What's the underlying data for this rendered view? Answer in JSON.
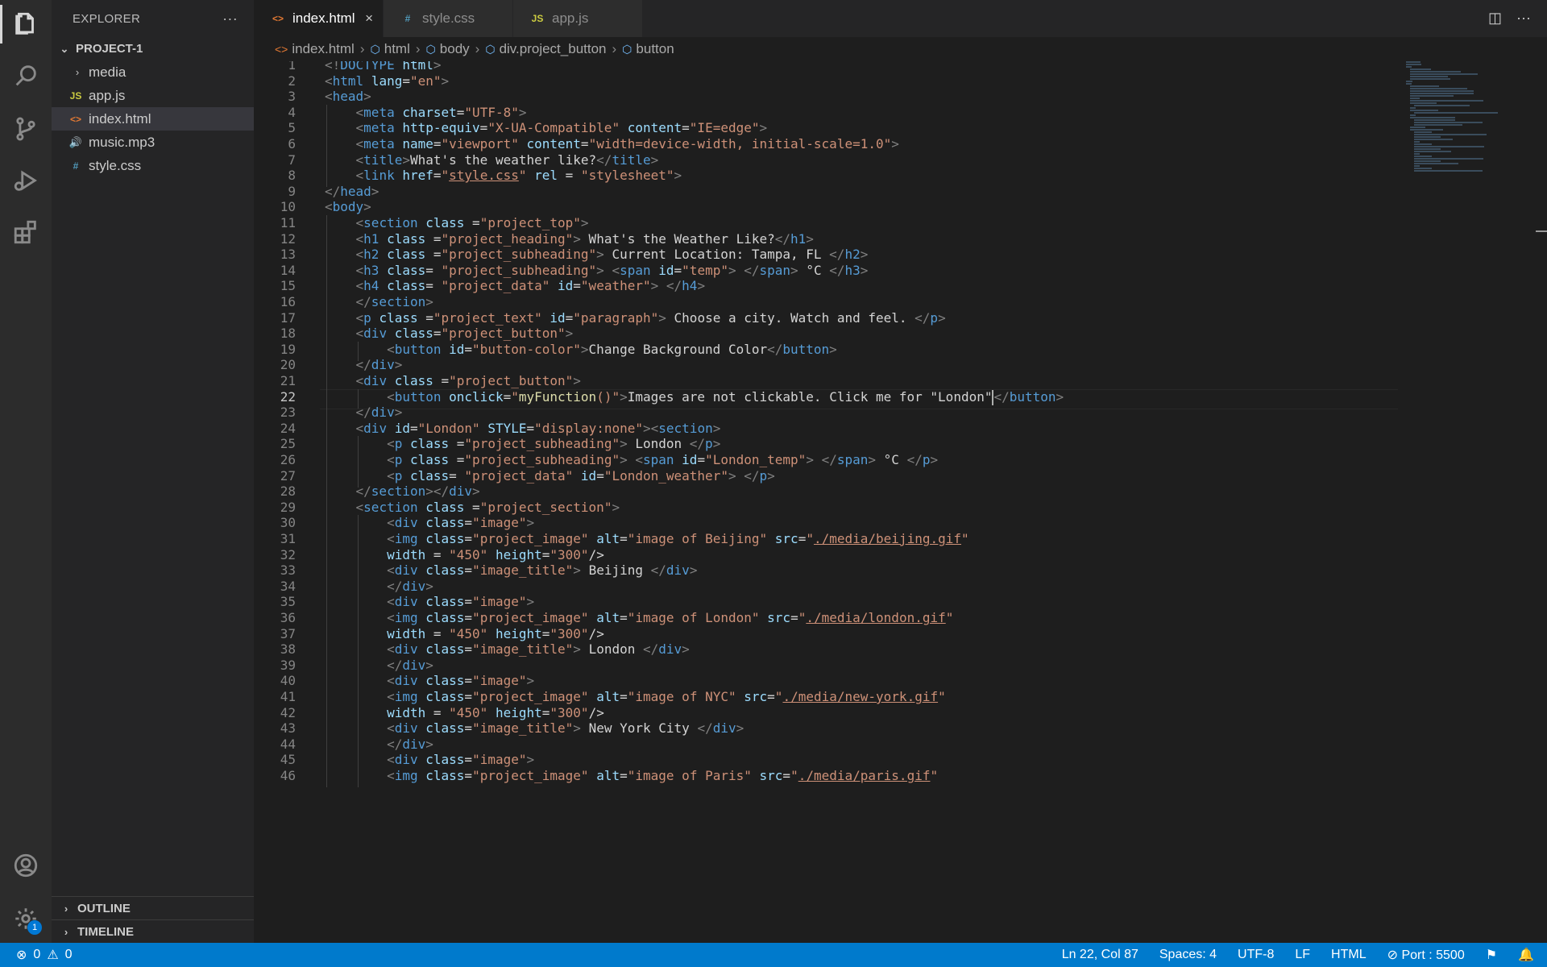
{
  "sidebar": {
    "title": "EXPLORER",
    "more": "···",
    "project": "PROJECT-1",
    "items": [
      {
        "label": "media",
        "type": "folder"
      },
      {
        "label": "app.js",
        "type": "js",
        "icon_text": "JS"
      },
      {
        "label": "index.html",
        "type": "html",
        "icon_text": "<>"
      },
      {
        "label": "music.mp3",
        "type": "audio",
        "icon_text": "🔊"
      },
      {
        "label": "style.css",
        "type": "css",
        "icon_text": "#"
      }
    ],
    "outline": "OUTLINE",
    "timeline": "TIMELINE"
  },
  "tabs": [
    {
      "label": "index.html",
      "icon_text": "<>",
      "active": true,
      "close": "×"
    },
    {
      "label": "style.css",
      "icon_text": "#"
    },
    {
      "label": "app.js",
      "icon_text": "JS"
    }
  ],
  "breadcrumb": {
    "file": "index.html",
    "items": [
      "html",
      "body",
      "div.project_button",
      "button"
    ]
  },
  "editor": {
    "current_line": 22,
    "lines": [
      "<!DOCTYPE html>",
      "<html lang=\"en\">",
      "<head>",
      "    <meta charset=\"UTF-8\">",
      "    <meta http-equiv=\"X-UA-Compatible\" content=\"IE=edge\">",
      "    <meta name=\"viewport\" content=\"width=device-width, initial-scale=1.0\">",
      "    <title>What's the weather like?</title>",
      "    <link href=\"style.css\" rel = \"stylesheet\">",
      "</head>",
      "<body>",
      "    <section class =\"project_top\">",
      "    <h1 class =\"project_heading\"> What's the Weather Like?</h1>",
      "    <h2 class =\"project_subheading\"> Current Location: Tampa, FL </h2>",
      "    <h3 class= \"project_subheading\"> <span id=\"temp\"> </span> °C </h3>",
      "    <h4 class= \"project_data\" id=\"weather\"> </h4>",
      "    </section>",
      "    <p class =\"project_text\" id=\"paragraph\"> Choose a city. Watch and feel. </p>",
      "    <div class=\"project_button\">",
      "        <button id=\"button-color\">Change Background Color</button>",
      "    </div>",
      "    <div class =\"project_button\">",
      "        <button onclick=\"myFunction()\">Images are not clickable. Click me for \"London\"</button>",
      "    </div>",
      "    <div id=\"London\" STYLE=\"display:none\"><section>",
      "        <p class =\"project_subheading\"> London </p>",
      "        <p class =\"project_subheading\"> <span id=\"London_temp\"> </span> °C </p>",
      "        <p class= \"project_data\" id=\"London_weather\"> </p>",
      "    </section></div>",
      "    <section class =\"project_section\">",
      "        <div class=\"image\">",
      "        <img class=\"project_image\" alt=\"image of Beijing\" src=\"./media/beijing.gif\"",
      "        width = \"450\" height=\"300\"/>",
      "        <div class=\"image_title\"> Beijing </div>",
      "        </div>",
      "        <div class=\"image\">",
      "        <img class=\"project_image\" alt=\"image of London\" src=\"./media/london.gif\"",
      "        width = \"450\" height=\"300\"/>",
      "        <div class=\"image_title\"> London </div>",
      "        </div>",
      "        <div class=\"image\">",
      "        <img class=\"project_image\" alt=\"image of NYC\" src=\"./media/new-york.gif\"",
      "        width = \"450\" height=\"300\"/>",
      "        <div class=\"image_title\"> New York City </div>",
      "        </div>",
      "        <div class=\"image\">",
      "        <img class=\"project_image\" alt=\"image of Paris\" src=\"./media/paris.gif\""
    ]
  },
  "activity_badge": "1",
  "status": {
    "errors": "0",
    "warnings": "0",
    "position": "Ln 22, Col 87",
    "spaces": "Spaces: 4",
    "encoding": "UTF-8",
    "eol": "LF",
    "language": "HTML",
    "port": "Port : 5500"
  },
  "colors": {
    "accent": "#007acc",
    "tag": "#569cd6",
    "attribute": "#9cdcfe",
    "string": "#ce9178",
    "js_icon": "#cbcb41",
    "html_icon": "#e37933",
    "css_icon": "#519aba",
    "audio_icon": "#a074c4"
  }
}
